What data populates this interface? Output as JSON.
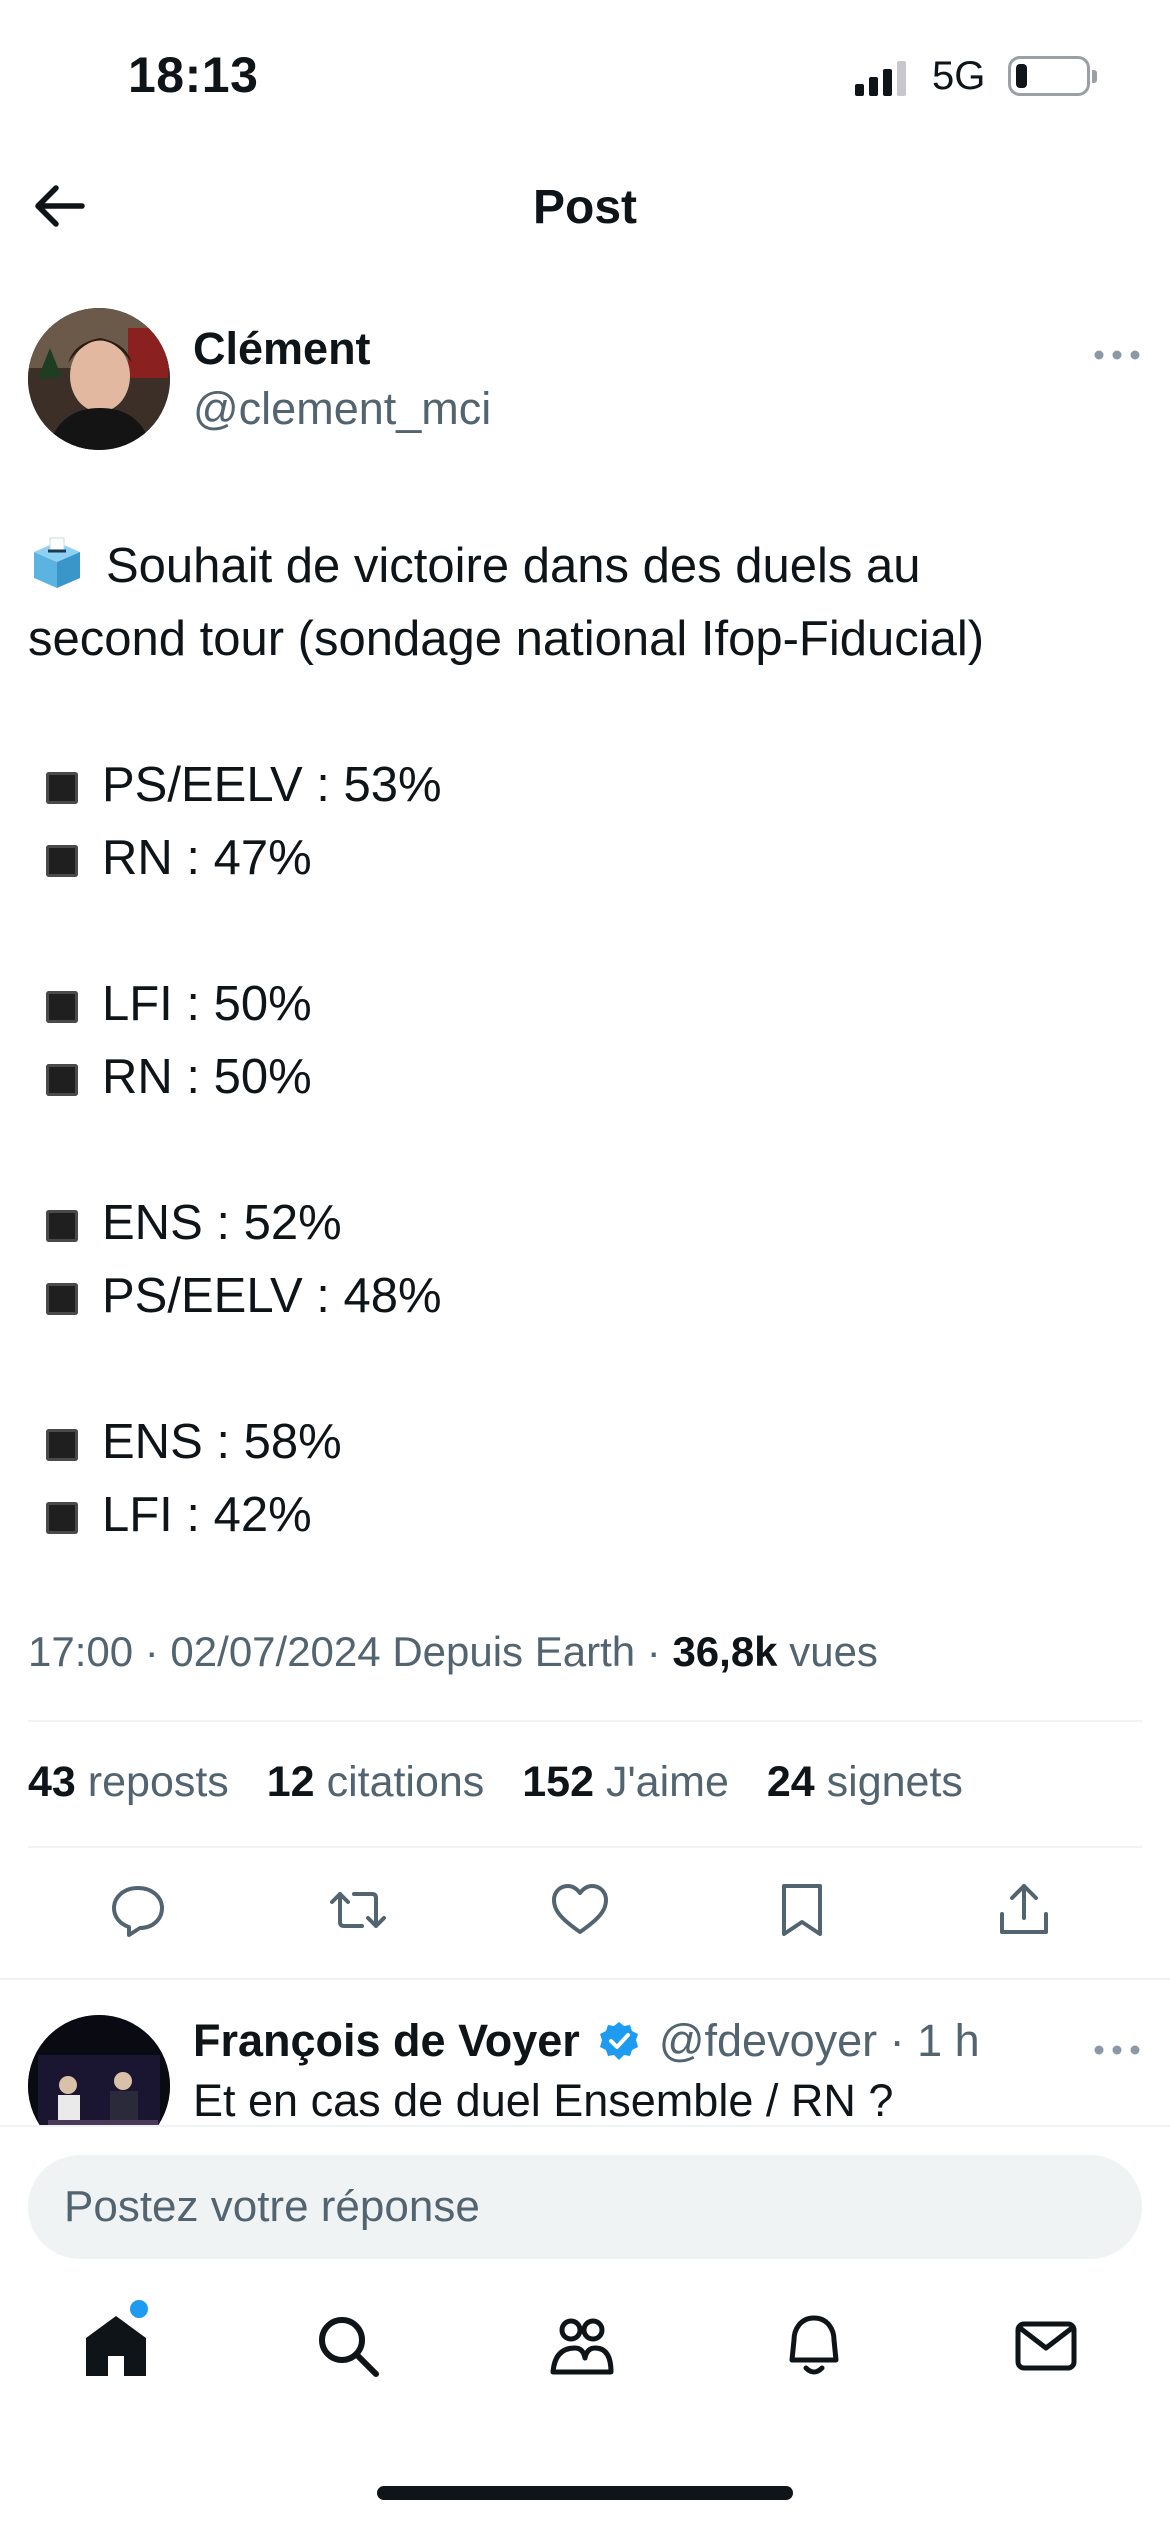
{
  "status_bar": {
    "time": "18:13",
    "network": "5G",
    "battery_level": 0.15
  },
  "header": {
    "title": "Post",
    "back_icon": "arrow-left-icon"
  },
  "post": {
    "author_name": "Clément",
    "author_handle": "@clement_mci",
    "lines": [
      {
        "text": "Souhait de victoire dans des duels au",
        "icon": "ballot-box-icon"
      },
      {
        "text": "second tour (sondage national Ifop-Fiducial)"
      },
      {
        "text": ""
      },
      {
        "text": "PS/EELV : 53%",
        "bullet": true
      },
      {
        "text": "RN : 47%",
        "bullet": true
      },
      {
        "text": ""
      },
      {
        "text": "LFI : 50%",
        "bullet": true
      },
      {
        "text": "RN : 50%",
        "bullet": true
      },
      {
        "text": ""
      },
      {
        "text": "ENS : 52%",
        "bullet": true
      },
      {
        "text": "PS/EELV : 48%",
        "bullet": true
      },
      {
        "text": ""
      },
      {
        "text": "ENS : 58%",
        "bullet": true
      },
      {
        "text": "LFI : 42%",
        "bullet": true
      }
    ],
    "meta": {
      "time_date": "17:00 · 02/07/2024",
      "source": "Depuis Earth ·",
      "views_count": "36,8k",
      "views_label": "vues"
    },
    "stats": [
      {
        "count": "43",
        "label": "reposts"
      },
      {
        "count": "12",
        "label": "citations"
      },
      {
        "count": "152",
        "label": "J'aime"
      },
      {
        "count": "24",
        "label": "signets"
      }
    ],
    "actions": [
      "reply-icon",
      "repost-icon",
      "like-icon",
      "bookmark-icon",
      "share-icon"
    ]
  },
  "reply": {
    "author_name": "François de Voyer",
    "author_handle": "@fdevoyer",
    "time": "· 1 h",
    "text": "Et en cas de duel Ensemble / RN ?",
    "verified_color": "#1d9bf0"
  },
  "composer": {
    "placeholder": "Postez votre réponse"
  },
  "tabs": [
    "home-icon",
    "search-icon",
    "communities-icon",
    "notifications-icon",
    "messages-icon"
  ],
  "colors": {
    "text": "#0f1419",
    "secondary": "#536471",
    "accent": "#1d9bf0"
  }
}
